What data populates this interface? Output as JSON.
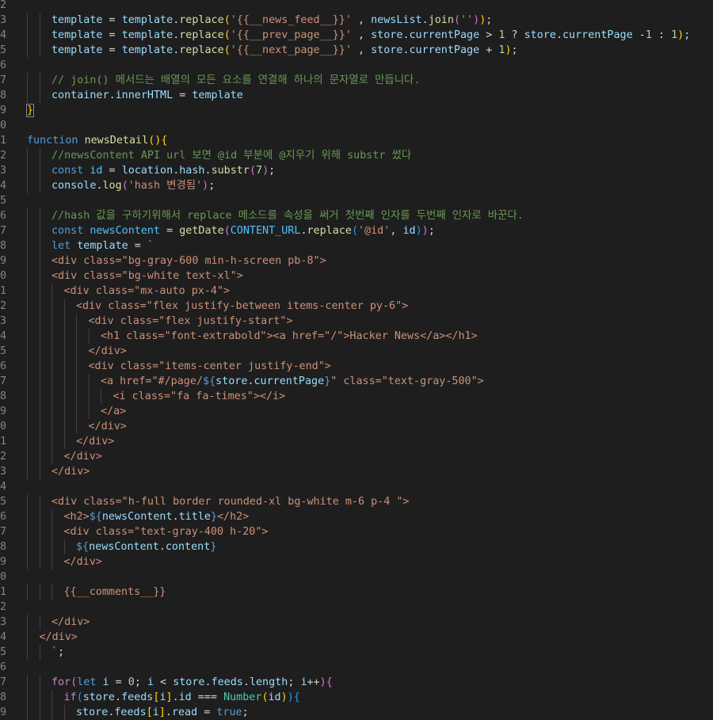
{
  "editor": {
    "language": "javascript",
    "theme_colors": {
      "background": "#1e1e1e",
      "line_number": "#858585",
      "keyword": "#569cd6",
      "function": "#dcdcaa",
      "variable": "#9cdcfe",
      "string": "#ce9178",
      "number": "#b5cea8",
      "comment": "#6a9955",
      "type": "#4ec9b0",
      "constant": "#4fc1ff"
    },
    "lines": [
      {
        "n": "2",
        "indent": 0,
        "tokens": []
      },
      {
        "n": "3",
        "indent": 2,
        "tokens": [
          [
            "var",
            "template"
          ],
          [
            "punc",
            " = "
          ],
          [
            "var",
            "template"
          ],
          [
            "punc",
            "."
          ],
          [
            "fn",
            "replace"
          ],
          [
            "brk1",
            "("
          ],
          [
            "str",
            "'{{__news_feed__}}'"
          ],
          [
            "punc",
            " , "
          ],
          [
            "var",
            "newsList"
          ],
          [
            "punc",
            "."
          ],
          [
            "fn",
            "join"
          ],
          [
            "brk2",
            "("
          ],
          [
            "str",
            "''"
          ],
          [
            "brk2",
            ")"
          ],
          [
            "brk1",
            ")"
          ],
          [
            "punc",
            ";"
          ]
        ]
      },
      {
        "n": "4",
        "indent": 2,
        "tokens": [
          [
            "var",
            "template"
          ],
          [
            "punc",
            " = "
          ],
          [
            "var",
            "template"
          ],
          [
            "punc",
            "."
          ],
          [
            "fn",
            "replace"
          ],
          [
            "brk1",
            "("
          ],
          [
            "str",
            "'{{__prev_page__}}'"
          ],
          [
            "punc",
            " , "
          ],
          [
            "var",
            "store"
          ],
          [
            "punc",
            "."
          ],
          [
            "var",
            "currentPage"
          ],
          [
            "punc",
            " > "
          ],
          [
            "num",
            "1"
          ],
          [
            "punc",
            " ? "
          ],
          [
            "var",
            "store"
          ],
          [
            "punc",
            "."
          ],
          [
            "var",
            "currentPage"
          ],
          [
            "punc",
            " -"
          ],
          [
            "num",
            "1"
          ],
          [
            "punc",
            " : "
          ],
          [
            "num",
            "1"
          ],
          [
            "brk1",
            ")"
          ],
          [
            "punc",
            ";"
          ]
        ]
      },
      {
        "n": "5",
        "indent": 2,
        "tokens": [
          [
            "var",
            "template"
          ],
          [
            "punc",
            " = "
          ],
          [
            "var",
            "template"
          ],
          [
            "punc",
            "."
          ],
          [
            "fn",
            "replace"
          ],
          [
            "brk1",
            "("
          ],
          [
            "str",
            "'{{__next_page__}}'"
          ],
          [
            "punc",
            " , "
          ],
          [
            "var",
            "store"
          ],
          [
            "punc",
            "."
          ],
          [
            "var",
            "currentPage"
          ],
          [
            "punc",
            " + "
          ],
          [
            "num",
            "1"
          ],
          [
            "brk1",
            ")"
          ],
          [
            "punc",
            ";"
          ]
        ]
      },
      {
        "n": "6",
        "indent": 0,
        "tokens": []
      },
      {
        "n": "7",
        "indent": 2,
        "tokens": [
          [
            "cmt",
            "// join() 메서드는 배열의 모든 요소를 연결해 하나의 문자열로 만듭니다."
          ]
        ]
      },
      {
        "n": "8",
        "indent": 2,
        "tokens": [
          [
            "var",
            "container"
          ],
          [
            "punc",
            "."
          ],
          [
            "var",
            "innerHTML"
          ],
          [
            "punc",
            " = "
          ],
          [
            "var",
            "template"
          ]
        ]
      },
      {
        "n": "9",
        "indent": 0,
        "tokens": [
          [
            "match",
            "}"
          ]
        ]
      },
      {
        "n": "0",
        "indent": 0,
        "tokens": []
      },
      {
        "n": "1",
        "indent": 0,
        "tokens": [
          [
            "kw",
            "function"
          ],
          [
            "punc",
            " "
          ],
          [
            "fn",
            "newsDetail"
          ],
          [
            "brk1",
            "()"
          ],
          [
            "brk1",
            "{"
          ]
        ]
      },
      {
        "n": "2",
        "indent": 2,
        "tokens": [
          [
            "cmt",
            "//newsContent API url 보면 @id 부분에 @지우기 위해 substr 썼다"
          ]
        ]
      },
      {
        "n": "3",
        "indent": 2,
        "tokens": [
          [
            "kw",
            "const"
          ],
          [
            "punc",
            " "
          ],
          [
            "const",
            "id"
          ],
          [
            "punc",
            " = "
          ],
          [
            "var",
            "location"
          ],
          [
            "punc",
            "."
          ],
          [
            "var",
            "hash"
          ],
          [
            "punc",
            "."
          ],
          [
            "fn",
            "substr"
          ],
          [
            "brk2",
            "("
          ],
          [
            "num",
            "7"
          ],
          [
            "brk2",
            ")"
          ],
          [
            "punc",
            ";"
          ]
        ]
      },
      {
        "n": "4",
        "indent": 2,
        "tokens": [
          [
            "var",
            "console"
          ],
          [
            "punc",
            "."
          ],
          [
            "fn",
            "log"
          ],
          [
            "brk2",
            "("
          ],
          [
            "str",
            "'hash 변경됨'"
          ],
          [
            "brk2",
            ")"
          ],
          [
            "punc",
            ";"
          ]
        ]
      },
      {
        "n": "5",
        "indent": 0,
        "tokens": []
      },
      {
        "n": "6",
        "indent": 2,
        "tokens": [
          [
            "cmt",
            "//hash 값을 구하기위해서 replace 메소드를 속성을 써거 첫번째 인자를 두번째 인자로 바꾼다."
          ]
        ]
      },
      {
        "n": "7",
        "indent": 2,
        "tokens": [
          [
            "kw",
            "const"
          ],
          [
            "punc",
            " "
          ],
          [
            "const",
            "newsContent"
          ],
          [
            "punc",
            " = "
          ],
          [
            "fn",
            "getDate"
          ],
          [
            "brk2",
            "("
          ],
          [
            "const",
            "CONTENT_URL"
          ],
          [
            "punc",
            "."
          ],
          [
            "fn",
            "replace"
          ],
          [
            "brk3",
            "("
          ],
          [
            "str",
            "'@id'"
          ],
          [
            "punc",
            ", "
          ],
          [
            "var",
            "id"
          ],
          [
            "brk3",
            ")"
          ],
          [
            "brk2",
            ")"
          ],
          [
            "punc",
            ";"
          ]
        ]
      },
      {
        "n": "8",
        "indent": 2,
        "tokens": [
          [
            "kw",
            "let"
          ],
          [
            "punc",
            " "
          ],
          [
            "var",
            "template"
          ],
          [
            "punc",
            " = "
          ],
          [
            "str",
            "`"
          ]
        ]
      },
      {
        "n": "9",
        "indent": 2,
        "tokens": [
          [
            "str",
            "<div class=\"bg-gray-600 min-h-screen pb-8\">"
          ]
        ]
      },
      {
        "n": "0",
        "indent": 2,
        "tokens": [
          [
            "str",
            "<div class=\"bg-white text-xl\">"
          ]
        ]
      },
      {
        "n": "1",
        "indent": 3,
        "tokens": [
          [
            "str",
            "<div class=\"mx-auto px-4\">"
          ]
        ]
      },
      {
        "n": "2",
        "indent": 4,
        "tokens": [
          [
            "str",
            "<div class=\"flex justify-between items-center py-6\">"
          ]
        ]
      },
      {
        "n": "3",
        "indent": 5,
        "tokens": [
          [
            "str",
            "<div class=\"flex justify-start\">"
          ]
        ]
      },
      {
        "n": "4",
        "indent": 6,
        "tokens": [
          [
            "str",
            "<h1 class=\"font-extrabold\"><a href=\"/\">Hacker News</a></h1>"
          ]
        ]
      },
      {
        "n": "5",
        "indent": 5,
        "tokens": [
          [
            "str",
            "</div>"
          ]
        ]
      },
      {
        "n": "6",
        "indent": 5,
        "tokens": [
          [
            "str",
            "<div class=\"items-center justify-end\">"
          ]
        ]
      },
      {
        "n": "7",
        "indent": 6,
        "tokens": [
          [
            "str",
            "<a href=\"#/page/"
          ],
          [
            "kw",
            "${"
          ],
          [
            "var",
            "store"
          ],
          [
            "punc",
            "."
          ],
          [
            "var",
            "currentPage"
          ],
          [
            "kw",
            "}"
          ],
          [
            "str",
            "\" class=\"text-gray-500\">"
          ]
        ]
      },
      {
        "n": "8",
        "indent": 7,
        "tokens": [
          [
            "str",
            "<i class=\"fa fa-times\"></i>"
          ]
        ]
      },
      {
        "n": "9",
        "indent": 6,
        "tokens": [
          [
            "str",
            "</a>"
          ]
        ]
      },
      {
        "n": "0",
        "indent": 5,
        "tokens": [
          [
            "str",
            "</div>"
          ]
        ]
      },
      {
        "n": "1",
        "indent": 4,
        "tokens": [
          [
            "str",
            "</div>"
          ]
        ]
      },
      {
        "n": "2",
        "indent": 3,
        "tokens": [
          [
            "str",
            "</div>"
          ]
        ]
      },
      {
        "n": "3",
        "indent": 2,
        "tokens": [
          [
            "str",
            "</div>"
          ]
        ]
      },
      {
        "n": "4",
        "indent": 0,
        "tokens": []
      },
      {
        "n": "5",
        "indent": 2,
        "tokens": [
          [
            "str",
            "<div class=\"h-full border rounded-xl bg-white m-6 p-4 \">"
          ]
        ]
      },
      {
        "n": "6",
        "indent": 3,
        "tokens": [
          [
            "str",
            "<h2>"
          ],
          [
            "kw",
            "${"
          ],
          [
            "var",
            "newsContent"
          ],
          [
            "punc",
            "."
          ],
          [
            "var",
            "title"
          ],
          [
            "kw",
            "}"
          ],
          [
            "str",
            "</h2>"
          ]
        ]
      },
      {
        "n": "7",
        "indent": 3,
        "tokens": [
          [
            "str",
            "<div class=\"text-gray-400 h-20\">"
          ]
        ]
      },
      {
        "n": "8",
        "indent": 4,
        "tokens": [
          [
            "kw",
            "${"
          ],
          [
            "var",
            "newsContent"
          ],
          [
            "punc",
            "."
          ],
          [
            "var",
            "content"
          ],
          [
            "kw",
            "}"
          ]
        ]
      },
      {
        "n": "9",
        "indent": 3,
        "tokens": [
          [
            "str",
            "</div>"
          ]
        ]
      },
      {
        "n": "0",
        "indent": 0,
        "tokens": []
      },
      {
        "n": "1",
        "indent": 3,
        "tokens": [
          [
            "str",
            "{{__comments__}}"
          ]
        ]
      },
      {
        "n": "2",
        "indent": 0,
        "tokens": []
      },
      {
        "n": "3",
        "indent": 2,
        "tokens": [
          [
            "str",
            "</div>"
          ]
        ]
      },
      {
        "n": "4",
        "indent": 1,
        "tokens": [
          [
            "str",
            "</div>"
          ]
        ]
      },
      {
        "n": "5",
        "indent": 2,
        "tokens": [
          [
            "str",
            "`"
          ],
          [
            "punc",
            ";"
          ]
        ]
      },
      {
        "n": "6",
        "indent": 0,
        "tokens": []
      },
      {
        "n": "7",
        "indent": 2,
        "tokens": [
          [
            "ctl",
            "for"
          ],
          [
            "brk2",
            "("
          ],
          [
            "kw",
            "let"
          ],
          [
            "punc",
            " "
          ],
          [
            "var",
            "i"
          ],
          [
            "punc",
            " = "
          ],
          [
            "num",
            "0"
          ],
          [
            "punc",
            "; "
          ],
          [
            "var",
            "i"
          ],
          [
            "punc",
            " < "
          ],
          [
            "var",
            "store"
          ],
          [
            "punc",
            "."
          ],
          [
            "var",
            "feeds"
          ],
          [
            "punc",
            "."
          ],
          [
            "var",
            "length"
          ],
          [
            "punc",
            "; "
          ],
          [
            "var",
            "i"
          ],
          [
            "punc",
            "++"
          ],
          [
            "brk2",
            ")"
          ],
          [
            "brk2",
            "{"
          ]
        ]
      },
      {
        "n": "8",
        "indent": 3,
        "tokens": [
          [
            "ctl",
            "if"
          ],
          [
            "brk3",
            "("
          ],
          [
            "var",
            "store"
          ],
          [
            "punc",
            "."
          ],
          [
            "var",
            "feeds"
          ],
          [
            "brk1",
            "["
          ],
          [
            "var",
            "i"
          ],
          [
            "brk1",
            "]"
          ],
          [
            "punc",
            "."
          ],
          [
            "var",
            "id"
          ],
          [
            "punc",
            " === "
          ],
          [
            "cls",
            "Number"
          ],
          [
            "brk1",
            "("
          ],
          [
            "var",
            "id"
          ],
          [
            "brk1",
            ")"
          ],
          [
            "brk3",
            ")"
          ],
          [
            "brk3",
            "{"
          ]
        ]
      },
      {
        "n": "9",
        "indent": 4,
        "tokens": [
          [
            "var",
            "store"
          ],
          [
            "punc",
            "."
          ],
          [
            "var",
            "feeds"
          ],
          [
            "brk1",
            "["
          ],
          [
            "var",
            "i"
          ],
          [
            "brk1",
            "]"
          ],
          [
            "punc",
            "."
          ],
          [
            "var",
            "read"
          ],
          [
            "punc",
            " = "
          ],
          [
            "kw",
            "true"
          ],
          [
            "punc",
            ";"
          ]
        ]
      }
    ]
  }
}
